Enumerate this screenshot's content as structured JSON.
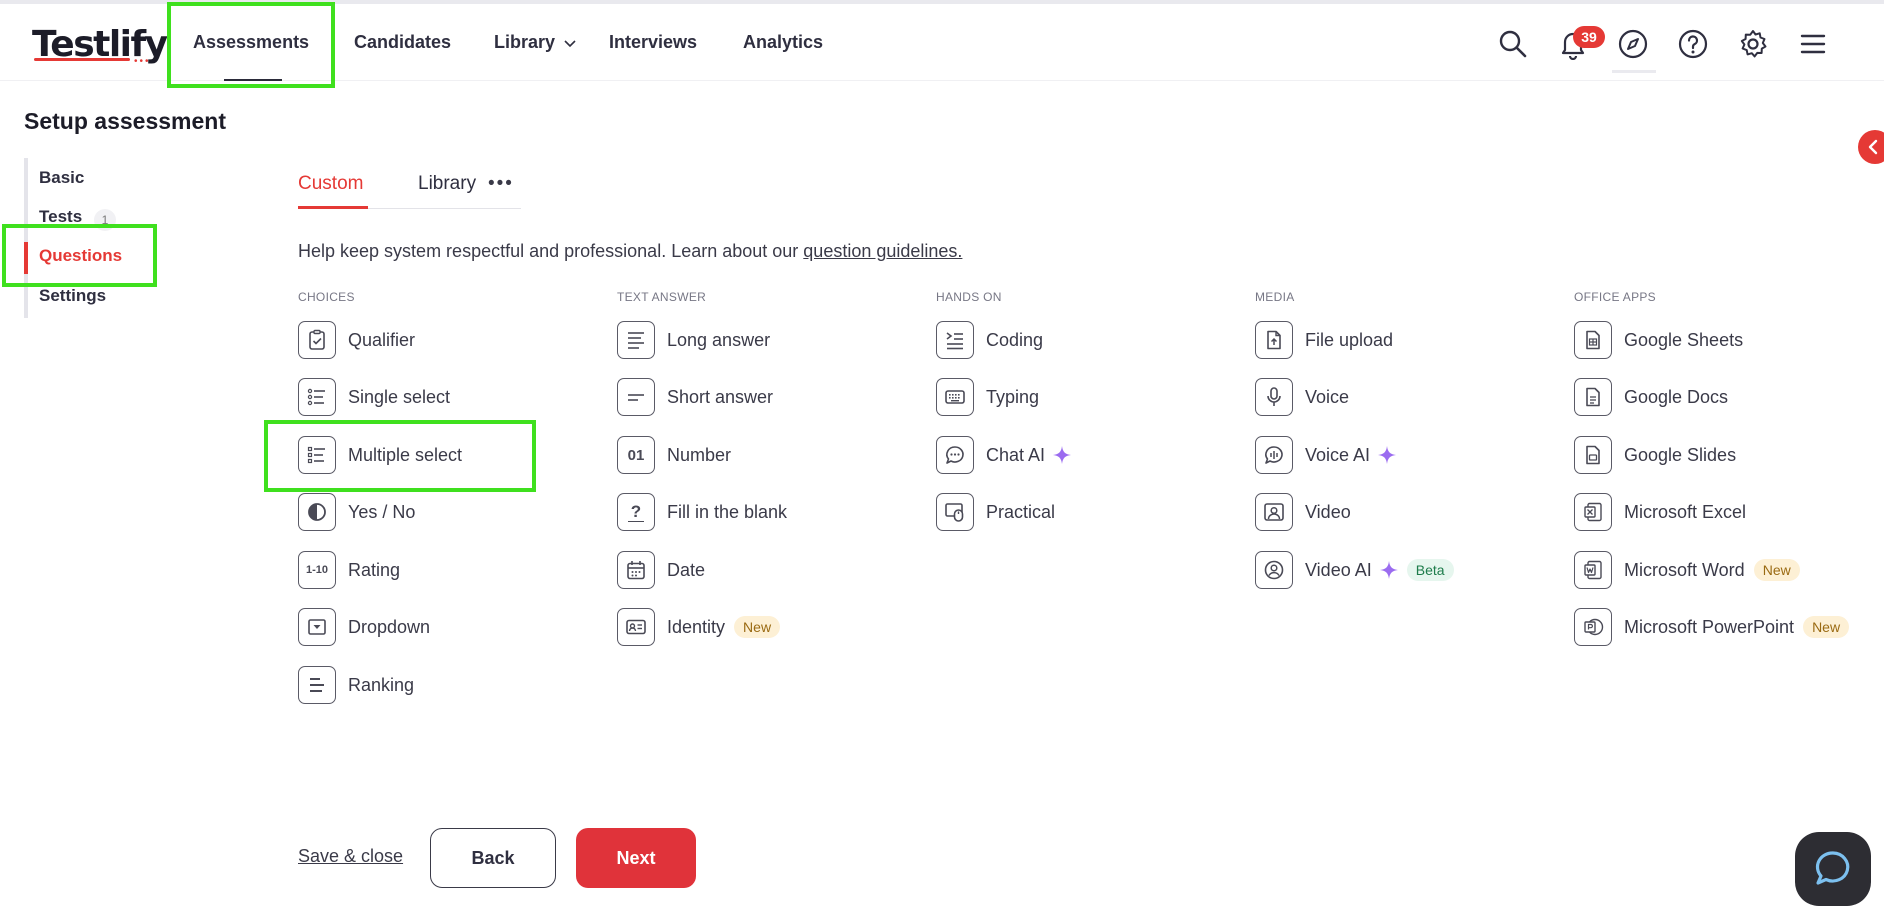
{
  "header": {
    "logo": "Testlify",
    "nav": [
      "Assessments",
      "Candidates",
      "Library",
      "Interviews",
      "Analytics"
    ],
    "notifications_count": "39",
    "icons": [
      "search-icon",
      "bell-icon",
      "compass-icon",
      "help-icon",
      "gear-icon",
      "menu-icon"
    ]
  },
  "page": {
    "title": "Setup assessment",
    "steps": [
      "Basic",
      "Tests",
      "Questions",
      "Settings"
    ],
    "tests_count": "1",
    "active_step": "Questions"
  },
  "tabs": {
    "custom": "Custom",
    "library": "Library",
    "more": "•••"
  },
  "info": {
    "text": "Help keep system respectful and professional. Learn about our ",
    "link": "question guidelines."
  },
  "columns": {
    "choices": {
      "heading": "CHOICES",
      "items": [
        "Qualifier",
        "Single select",
        "Multiple select",
        "Yes / No",
        "Rating",
        "Dropdown",
        "Ranking"
      ]
    },
    "text_answer": {
      "heading": "TEXT ANSWER",
      "items": [
        "Long answer",
        "Short answer",
        "Number",
        "Fill in the blank",
        "Date",
        "Identity"
      ]
    },
    "hands_on": {
      "heading": "HANDS ON",
      "items": [
        "Coding",
        "Typing",
        "Chat AI",
        "Practical"
      ]
    },
    "media": {
      "heading": "MEDIA",
      "items": [
        "File upload",
        "Voice",
        "Voice AI",
        "Video",
        "Video AI"
      ]
    },
    "office_apps": {
      "heading": "OFFICE APPS",
      "items": [
        "Google Sheets",
        "Google Docs",
        "Google Slides",
        "Microsoft Excel",
        "Microsoft Word",
        "Microsoft PowerPoint"
      ]
    }
  },
  "tags": {
    "new": "New",
    "beta": "Beta"
  },
  "icon_glyphs": {
    "number": "01",
    "rating": "1-10",
    "fill_blank": "?"
  },
  "footer": {
    "save_close": "Save & close",
    "back": "Back",
    "next": "Next"
  },
  "colors": {
    "accent": "#e53935",
    "highlight": "#3fe01e",
    "ai_sparkle": "#9b6cf0"
  }
}
